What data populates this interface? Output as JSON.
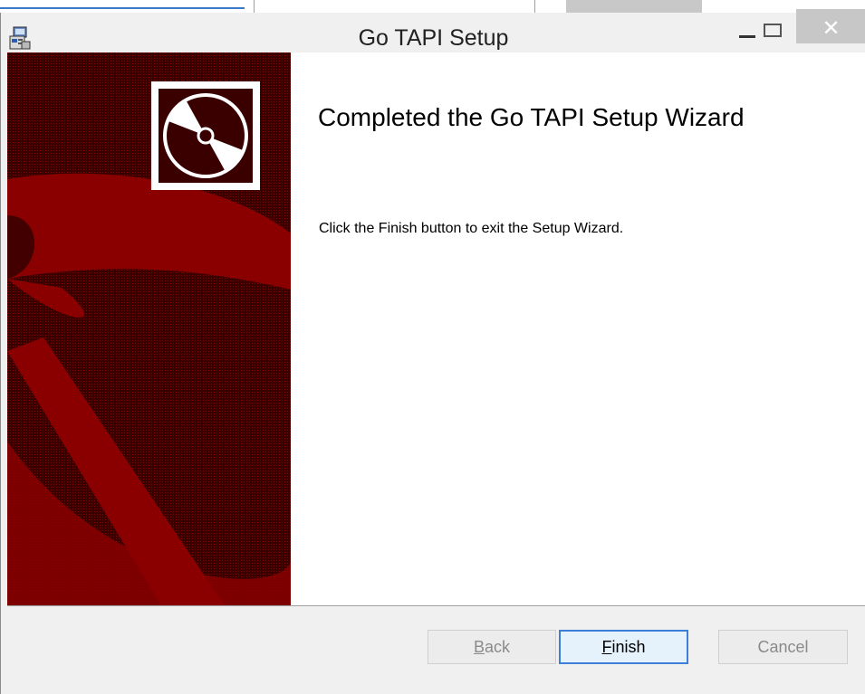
{
  "window": {
    "title": "Go TAPI Setup"
  },
  "content": {
    "heading": "Completed the Go TAPI Setup Wizard",
    "body": "Click the Finish button to exit the Setup Wizard."
  },
  "buttons": {
    "back": {
      "accel": "B",
      "rest": "ack",
      "enabled": false
    },
    "finish": {
      "accel": "F",
      "rest": "inish",
      "enabled": true,
      "default": true
    },
    "cancel": {
      "label": "Cancel",
      "enabled": false
    }
  },
  "icons": {
    "app": "setup-installer-icon",
    "banner": "cd-disc-icon",
    "minimize": "minimize-icon",
    "maximize": "maximize-icon",
    "close": "close-icon"
  },
  "colors": {
    "banner_dark": "#3a0000",
    "banner_red": "#8a0000",
    "close_button": "#c7c7c7",
    "default_button_border": "#3c7fd8"
  }
}
